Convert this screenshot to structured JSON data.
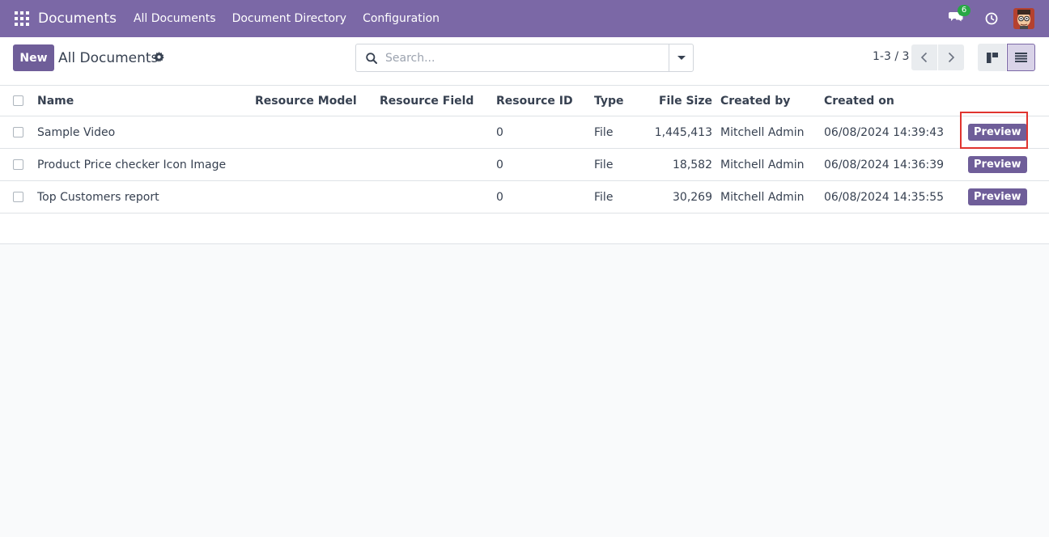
{
  "navbar": {
    "brand": "Documents",
    "menu": [
      "All Documents",
      "Document Directory",
      "Configuration"
    ],
    "chat_badge": "6",
    "icons": [
      "apps-grid-icon",
      "chat-icon",
      "clock-icon"
    ]
  },
  "control_panel": {
    "new_label": "New",
    "title": "All Documents",
    "search_placeholder": "Search...",
    "pager": "1-3 / 3"
  },
  "table": {
    "headers": {
      "name": "Name",
      "resource_model": "Resource Model",
      "resource_field": "Resource Field",
      "resource_id": "Resource ID",
      "type": "Type",
      "file_size": "File Size",
      "created_by": "Created by",
      "created_on": "Created on"
    },
    "rows": [
      {
        "name": "Sample Video",
        "resource_model": "",
        "resource_field": "",
        "resource_id": "0",
        "type": "File",
        "file_size": "1,445,413",
        "created_by": "Mitchell Admin",
        "created_on": "06/08/2024 14:39:43",
        "action": "Preview"
      },
      {
        "name": "Product Price checker Icon Image",
        "resource_model": "",
        "resource_field": "",
        "resource_id": "0",
        "type": "File",
        "file_size": "18,582",
        "created_by": "Mitchell Admin",
        "created_on": "06/08/2024 14:36:39",
        "action": "Preview"
      },
      {
        "name": "Top Customers report",
        "resource_model": "",
        "resource_field": "",
        "resource_id": "0",
        "type": "File",
        "file_size": "30,269",
        "created_by": "Mitchell Admin",
        "created_on": "06/08/2024 14:35:55",
        "action": "Preview"
      }
    ]
  },
  "colors": {
    "navbar": "#7b68a6",
    "primary_button": "#6f5e99",
    "badge": "#28a745",
    "highlight": "#e0342f"
  }
}
